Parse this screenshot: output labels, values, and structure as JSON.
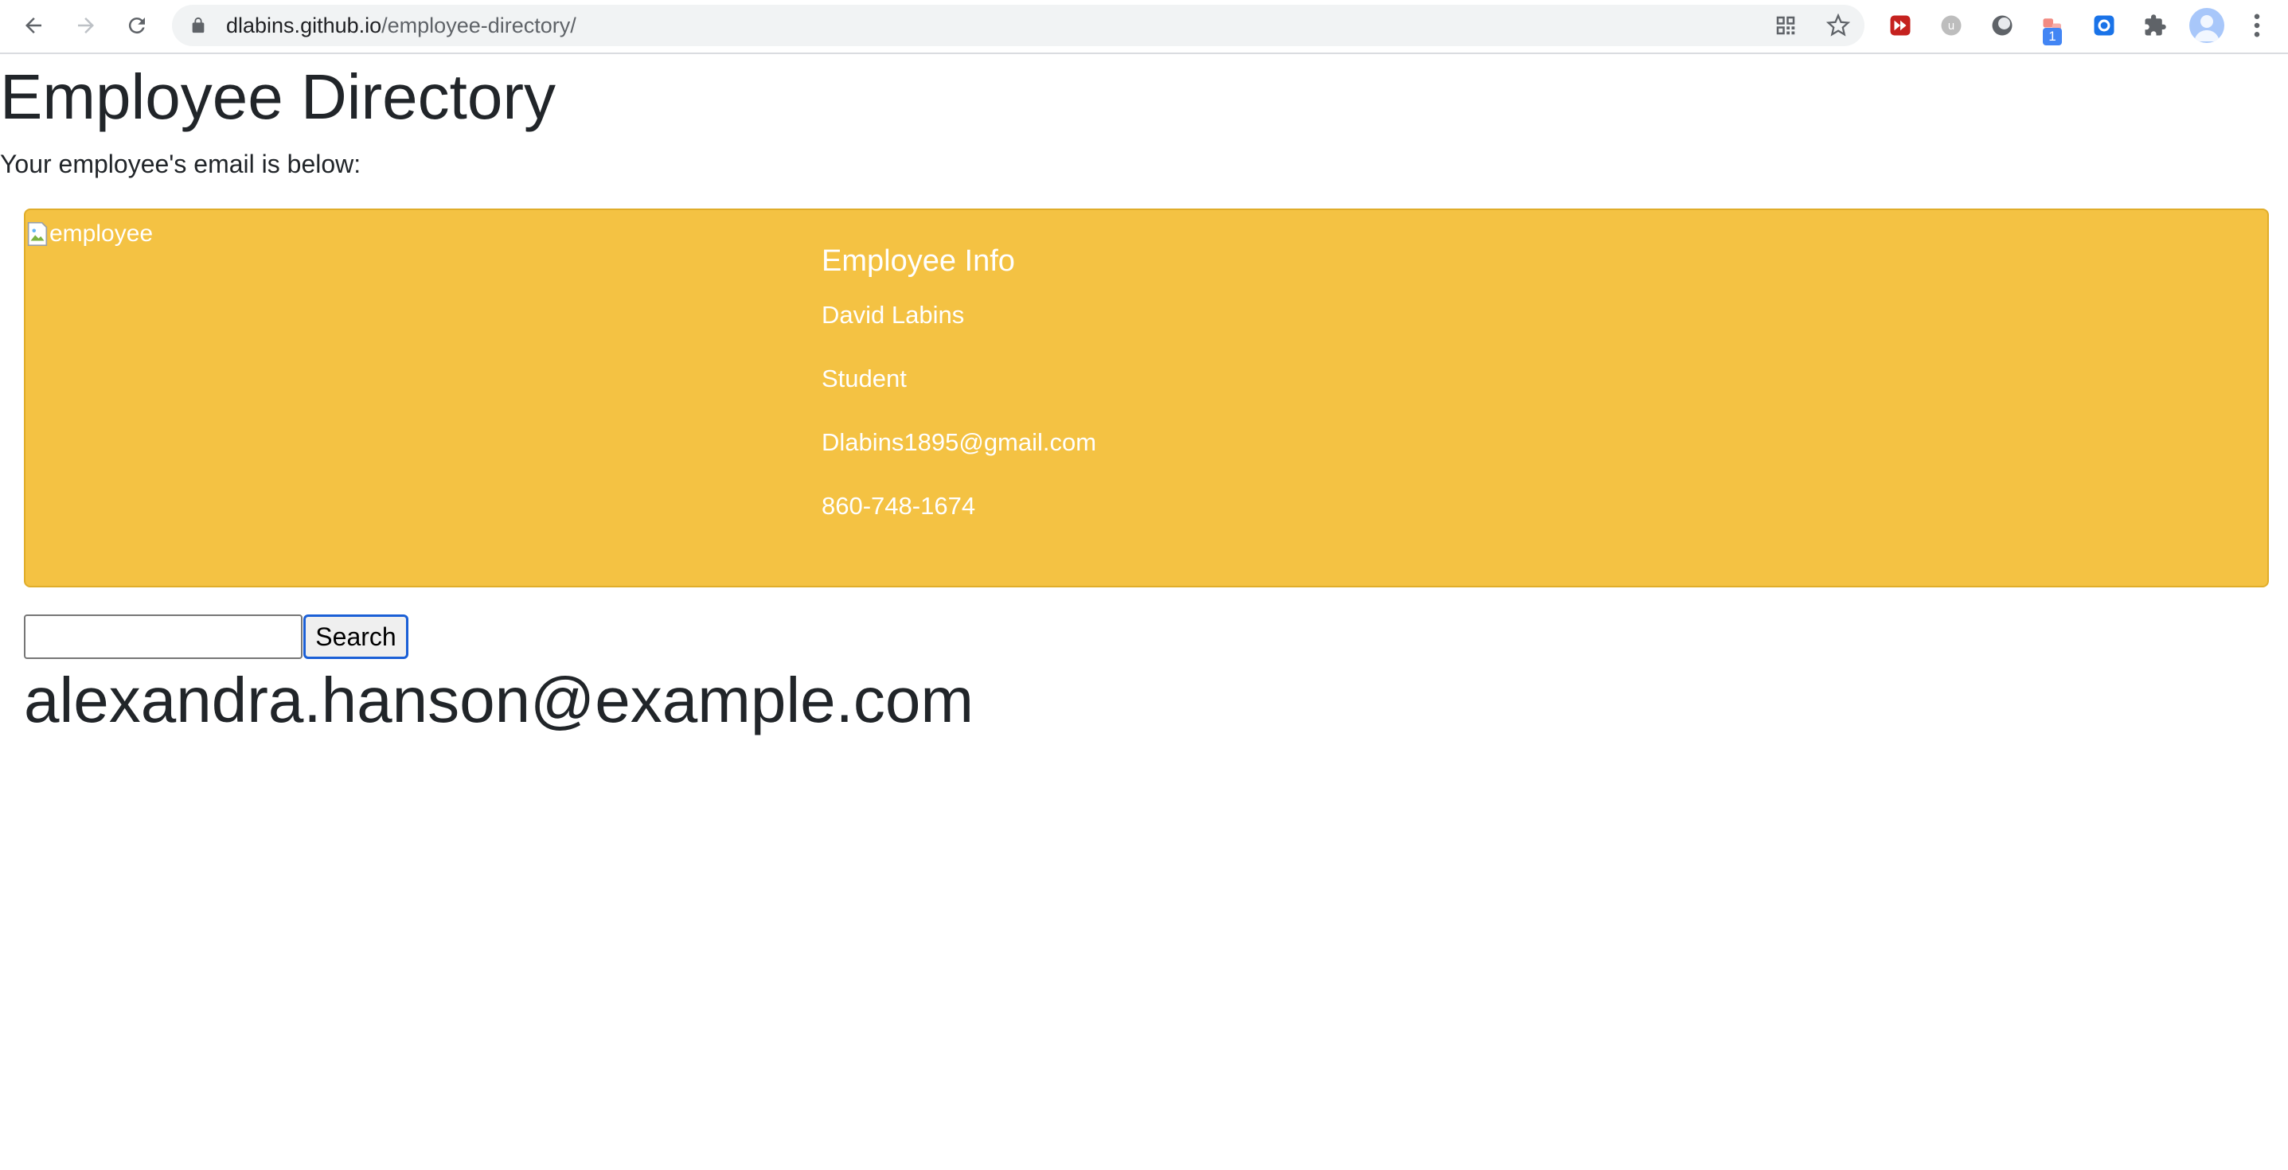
{
  "browser": {
    "url_host": "dlabins.github.io",
    "url_path": "/employee-directory/",
    "extension_badge": "1"
  },
  "page": {
    "title": "Employee Directory",
    "intro": "Your employee's email is below:"
  },
  "card": {
    "image_alt": "employee",
    "heading": "Employee Info",
    "name": "David Labins",
    "role": "Student",
    "email": "Dlabins1895@gmail.com",
    "phone": "860-748-1674",
    "background_color": "#f4c243"
  },
  "search": {
    "value": "",
    "button_label": "Search"
  },
  "result": {
    "email": "alexandra.hanson@example.com"
  }
}
